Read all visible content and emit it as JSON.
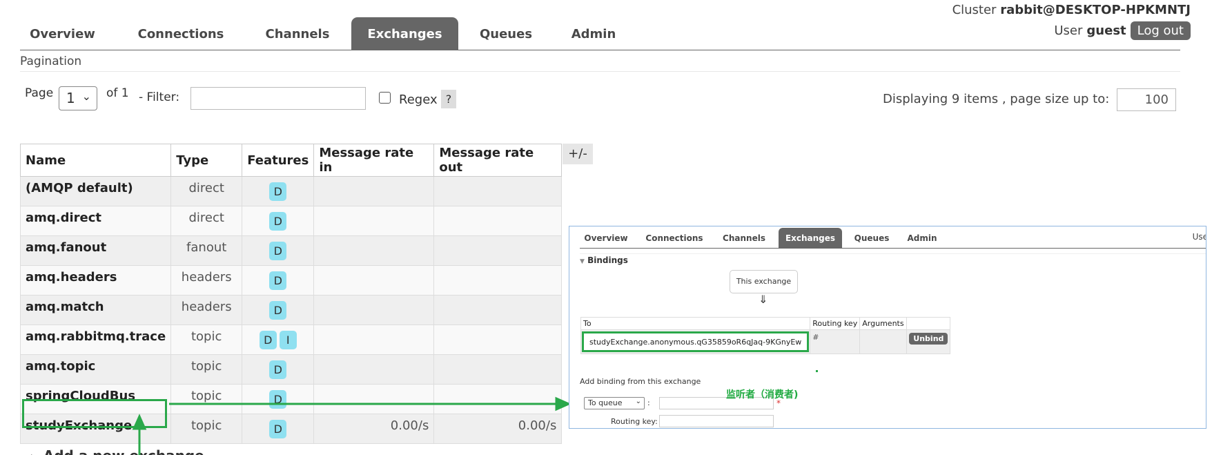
{
  "header": {
    "cluster_label": "Cluster",
    "cluster_name": "rabbit@DESKTOP-HPKMNTJ",
    "user_label": "User",
    "user_name": "guest",
    "logout_label": "Log out"
  },
  "tabs": [
    {
      "label": "Overview"
    },
    {
      "label": "Connections"
    },
    {
      "label": "Channels"
    },
    {
      "label": "Exchanges",
      "active": true
    },
    {
      "label": "Queues"
    },
    {
      "label": "Admin"
    }
  ],
  "pagination": {
    "section_title": "Pagination",
    "page_label": "Page",
    "page_value": "1",
    "of_label": "of 1",
    "filter_label": "- Filter:",
    "filter_value": "",
    "regex_label": "Regex",
    "regex_checked": false,
    "help_label": "?",
    "displaying_text": "Displaying 9 items , page size up to:",
    "page_size": "100"
  },
  "table": {
    "columns": [
      "Name",
      "Type",
      "Features",
      "Message rate in",
      "Message rate out"
    ],
    "toggle_label": "+/-",
    "rows": [
      {
        "name": "(AMQP default)",
        "type": "direct",
        "features": [
          "D"
        ],
        "rate_in": "",
        "rate_out": ""
      },
      {
        "name": "amq.direct",
        "type": "direct",
        "features": [
          "D"
        ],
        "rate_in": "",
        "rate_out": ""
      },
      {
        "name": "amq.fanout",
        "type": "fanout",
        "features": [
          "D"
        ],
        "rate_in": "",
        "rate_out": ""
      },
      {
        "name": "amq.headers",
        "type": "headers",
        "features": [
          "D"
        ],
        "rate_in": "",
        "rate_out": ""
      },
      {
        "name": "amq.match",
        "type": "headers",
        "features": [
          "D"
        ],
        "rate_in": "",
        "rate_out": ""
      },
      {
        "name": "amq.rabbitmq.trace",
        "type": "topic",
        "features": [
          "D",
          "I"
        ],
        "rate_in": "",
        "rate_out": ""
      },
      {
        "name": "amq.topic",
        "type": "topic",
        "features": [
          "D"
        ],
        "rate_in": "",
        "rate_out": ""
      },
      {
        "name": "springCloudBus",
        "type": "topic",
        "features": [
          "D"
        ],
        "rate_in": "",
        "rate_out": ""
      },
      {
        "name": "studyExchange",
        "type": "topic",
        "features": [
          "D"
        ],
        "rate_in": "0.00/s",
        "rate_out": "0.00/s"
      }
    ]
  },
  "add_section": {
    "label": "Add a new exchange"
  },
  "inset": {
    "tabs": [
      {
        "label": "Overview"
      },
      {
        "label": "Connections"
      },
      {
        "label": "Channels"
      },
      {
        "label": "Exchanges",
        "active": true
      },
      {
        "label": "Queues"
      },
      {
        "label": "Admin"
      }
    ],
    "user_partial": "Use",
    "bindings_title": "Bindings",
    "this_exchange_label": "This exchange",
    "arrow": "⇓",
    "bind_columns": [
      "To",
      "Routing key",
      "Arguments",
      ""
    ],
    "binding": {
      "to": "studyExchange.anonymous.qG35859oR6qJaq-9KGnyEw",
      "routing_key": "#",
      "arguments": "",
      "unbind_label": "Unbind"
    },
    "add_binding_title": "Add binding from this exchange",
    "to_queue_label": "To queue",
    "routing_key_label": "Routing key:",
    "required_mark": "*"
  },
  "annotation": {
    "listener_label": "监听者（消费者)",
    "color": "#2aa84a"
  }
}
